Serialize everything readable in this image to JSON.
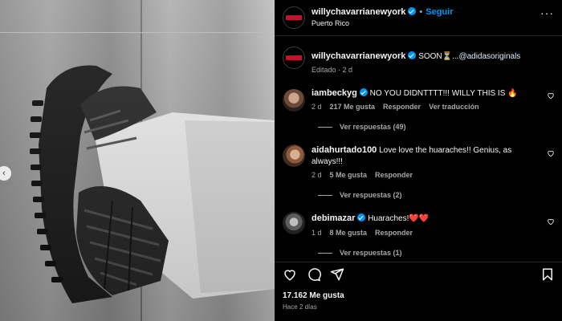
{
  "header": {
    "username": "willychavarrianewyork",
    "follow_label": "Seguir",
    "location": "Puerto Rico"
  },
  "caption": {
    "username": "willychavarrianewyork",
    "text_prefix": "SOON",
    "hourglass": "⏳",
    "ellipsis": "...",
    "mention": "@adidasoriginals",
    "meta": "Editado · 2 d"
  },
  "comments": [
    {
      "username": "iambeckyg",
      "verified": true,
      "text": "NO YOU DIDNTTTT!!! WILLY THIS IS 🔥",
      "age": "2 d",
      "likes": "217 Me gusta",
      "reply": "Responder",
      "translate": "Ver traducción",
      "replies": "Ver respuestas (49)"
    },
    {
      "username": "aidahurtado100",
      "verified": false,
      "text": "Love love the huaraches!! Genius, as always!!!",
      "age": "2 d",
      "likes": "5 Me gusta",
      "reply": "Responder",
      "replies": "Ver respuestas (2)"
    },
    {
      "username": "debimazar",
      "verified": true,
      "text": "Huaraches!❤️❤️",
      "age": "1 d",
      "likes": "8 Me gusta",
      "reply": "Responder",
      "replies": "Ver respuestas (1)"
    }
  ],
  "footer": {
    "likes": "17.162 Me gusta",
    "posted": "Hace 2 días"
  },
  "icons": [
    "chevron-left-icon",
    "verified-icon",
    "heart-icon",
    "comment-icon",
    "share-icon",
    "bookmark-icon"
  ],
  "colors": {
    "accent": "#0095f6",
    "background": "#000000",
    "text": "#f5f5f5",
    "muted": "#a8a8a8"
  }
}
